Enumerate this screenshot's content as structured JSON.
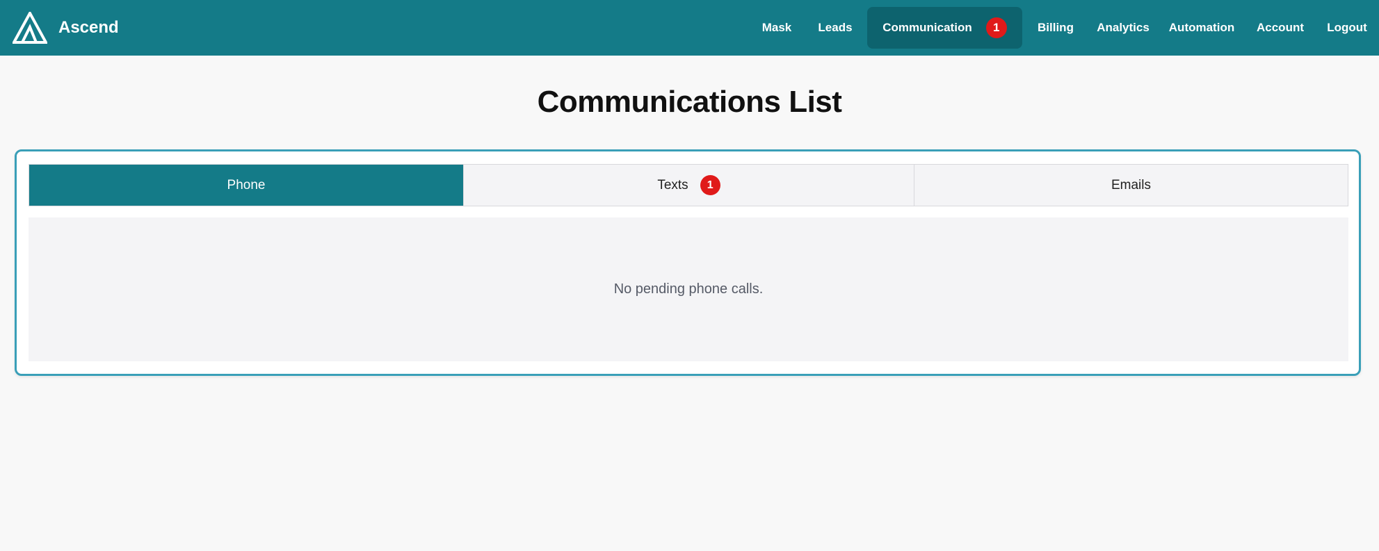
{
  "app": {
    "brand_name": "Ascend",
    "logo_icon": "ascend-logo-icon"
  },
  "nav": {
    "items": [
      {
        "label": "Mask"
      },
      {
        "label": "Leads"
      },
      {
        "label": "Communication",
        "badge": "1",
        "active": true
      },
      {
        "label": "Billing"
      },
      {
        "label": "Analytics"
      },
      {
        "label": "Automation"
      },
      {
        "label": "Account"
      },
      {
        "label": "Logout"
      }
    ]
  },
  "page": {
    "title": "Communications List"
  },
  "tabs": [
    {
      "label": "Phone",
      "active": true
    },
    {
      "label": "Texts",
      "badge": "1"
    },
    {
      "label": "Emails"
    }
  ],
  "content": {
    "empty_message": "No pending phone calls."
  },
  "colors": {
    "primary": "#147b88",
    "primary_dark": "#0d636e",
    "badge": "#e01a1a",
    "panel_border": "#3a9fb8",
    "background": "#f8f8f8"
  }
}
